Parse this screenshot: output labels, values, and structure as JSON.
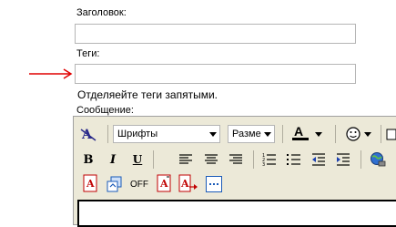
{
  "form": {
    "title_label": "Заголовок:",
    "tags_label": "Теги:",
    "tags_hint": "Отделяейте теги запятыми.",
    "message_label": "Сообщение:"
  },
  "annotation": {
    "arrow_color": "#e00000"
  },
  "editor": {
    "font_select": "Шрифты",
    "size_select": "Разме",
    "toggle_label": "OFF",
    "icons": [
      "format-icon",
      "font-color-icon",
      "emoji-icon",
      "bold-icon",
      "italic-icon",
      "underline-icon",
      "align-left-icon",
      "align-center-icon",
      "align-right-icon",
      "ordered-list-icon",
      "unordered-list-icon",
      "outdent-icon",
      "indent-icon",
      "globe-link-icon",
      "spellcheck-icon",
      "copy-icon",
      "text-box-icon",
      "text-box-arrow-icon",
      "more-icon"
    ]
  }
}
